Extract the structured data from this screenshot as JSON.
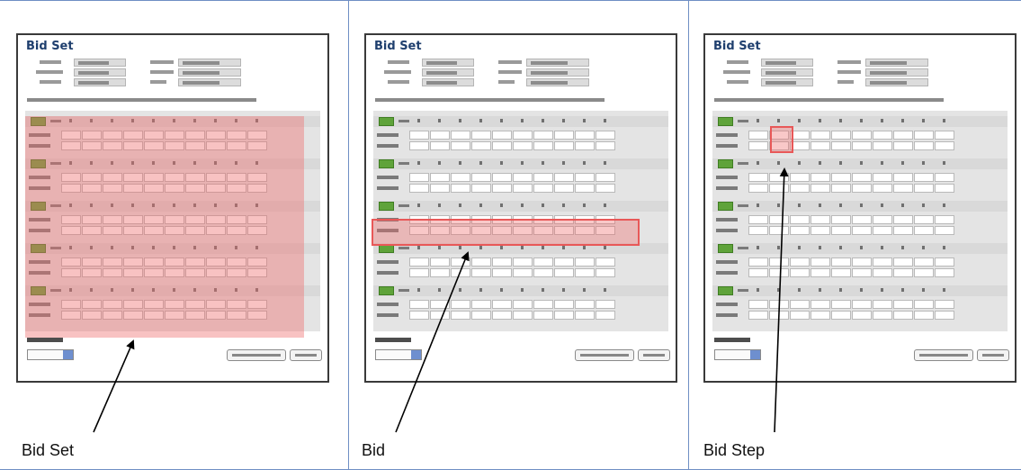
{
  "panels": [
    {
      "screen_title": "Bid Set",
      "caption": "Bid Set",
      "highlight": "bid-set"
    },
    {
      "screen_title": "Bid Set",
      "caption": "Bid",
      "highlight": "bid"
    },
    {
      "screen_title": "Bid Set",
      "caption": "Bid Step",
      "highlight": "bid-step"
    }
  ],
  "colors": {
    "panel_divider": "#6f8fc4",
    "highlight_fill": "#ee6e6e",
    "highlight_border": "#e85858",
    "bid_badge": "#5fa33a",
    "title_text": "#1f3f6e"
  },
  "screen_layout": {
    "bids_per_set": 5,
    "hour_columns": 10,
    "rows_per_bid": 2
  }
}
